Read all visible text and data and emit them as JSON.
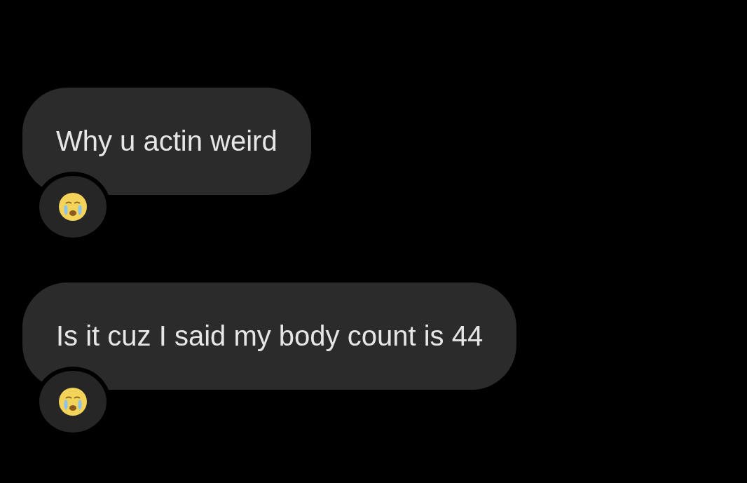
{
  "messages": [
    {
      "text": "Why u actin weird"
    },
    {
      "text": "Is it cuz I said my body count is 44"
    }
  ]
}
